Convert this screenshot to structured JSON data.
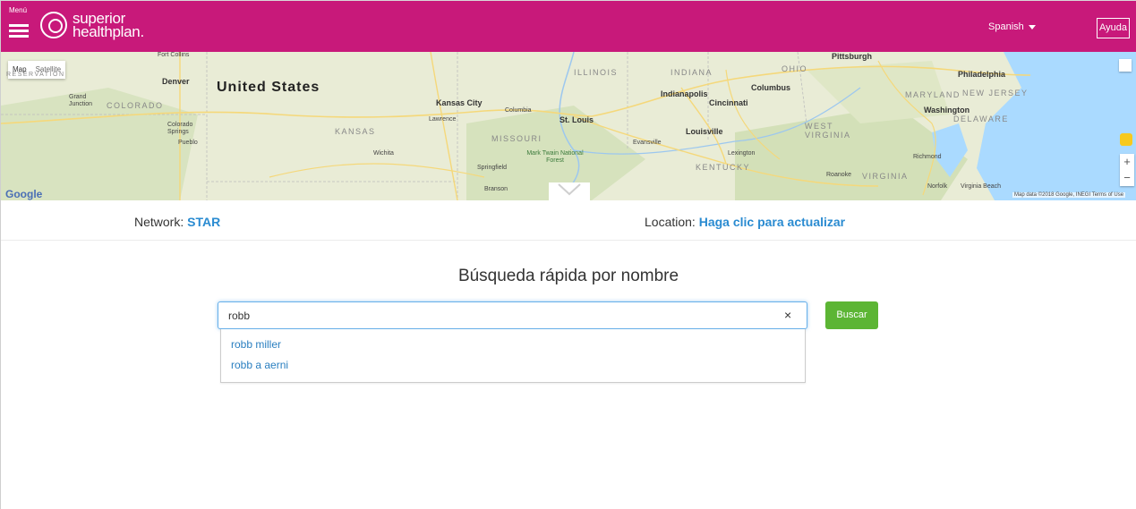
{
  "header": {
    "menu_label": "Menú",
    "brand_line1": "superior",
    "brand_line2": "healthplan.",
    "language": "Spanish",
    "help_label": "Ayuda",
    "brand_color": "#c8197a"
  },
  "map": {
    "type_map": "Map",
    "type_satellite": "Satellite",
    "country": "United States",
    "states": [
      "COLORADO",
      "KANSAS",
      "MISSOURI",
      "ILLINOIS",
      "INDIANA",
      "OHIO",
      "KENTUCKY",
      "WEST VIRGINIA",
      "VIRGINIA",
      "MARYLAND",
      "NEW JERSEY",
      "DELAWARE",
      "RESERVATION"
    ],
    "cities": [
      "Denver",
      "Kansas City",
      "St. Louis",
      "Columbus",
      "Indianapolis",
      "Cincinnati",
      "Louisville",
      "Pittsburgh",
      "Philadelphia",
      "Washington",
      "Wichita",
      "Springfield",
      "Evansville",
      "Lexington",
      "Richmond",
      "Norfolk",
      "Virginia Beach",
      "Roanoke",
      "Columbia",
      "Lawrence",
      "Colorado Springs",
      "Pueblo",
      "Grand Junction",
      "Fort Collins",
      "Branson",
      "Mark Twain National Forest"
    ],
    "google_label": "Google",
    "attribution": "Map data ©2018 Google, INEGI   Terms of Use"
  },
  "info": {
    "network_label": "Network:",
    "network_value": "STAR",
    "location_label": "Location:",
    "location_value": "Haga clic para actualizar"
  },
  "search": {
    "title": "Búsqueda rápida por nombre",
    "value": "robb",
    "clear_symbol": "×",
    "button_label": "Buscar",
    "suggestions": [
      "robb miller",
      "robb a aerni"
    ]
  }
}
